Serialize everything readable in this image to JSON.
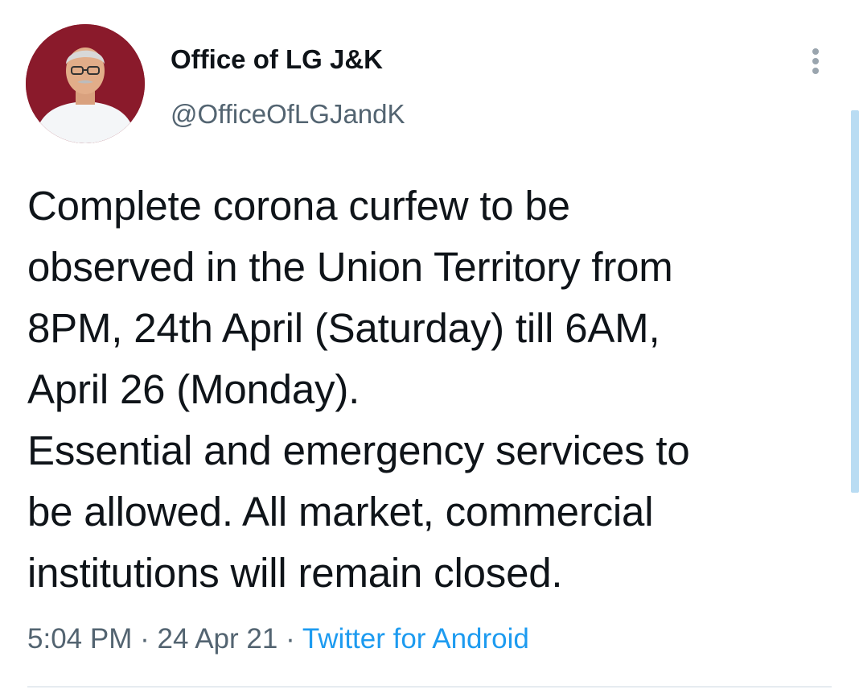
{
  "author": {
    "display_name": "Office of LG J&K",
    "handle": "@OfficeOfLGJandK",
    "avatar_bg": "#8a1a2b"
  },
  "tweet": {
    "lines": [
      "Complete corona curfew to be",
      "observed in the Union Territory from",
      "8PM, 24th April (Saturday) till 6AM,",
      "April 26 (Monday).",
      "Essential and emergency services to",
      "be allowed. All market, commercial",
      "institutions will remain closed."
    ]
  },
  "meta": {
    "time": "5:04 PM",
    "separator": "·",
    "date": "24 Apr 21",
    "source": "Twitter for Android"
  },
  "colors": {
    "text": "#0f1419",
    "secondary": "#536471",
    "link": "#1d9bf0",
    "scrollbar": "#b9dcf3"
  },
  "icons": {
    "more": "more-vertical-icon"
  }
}
